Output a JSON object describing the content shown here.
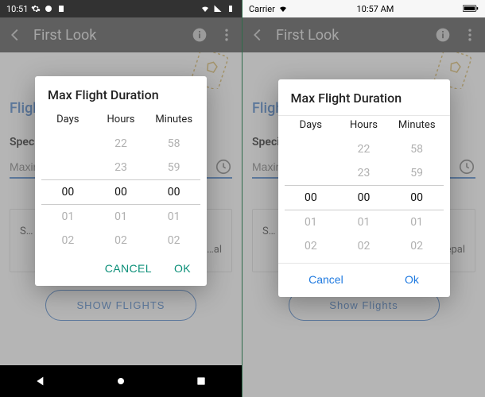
{
  "android": {
    "status": {
      "time": "10:51"
    },
    "appbar": {
      "title": "First Look"
    },
    "body": {
      "section_title": "Flight…",
      "specify": "Speci…",
      "input_placeholder": "Maximu…",
      "card_line1": "S…",
      "card_line2_suffix": "…al",
      "show_flights": "SHOW FLIGHTS"
    },
    "dialog": {
      "title": "Max Flight Duration",
      "columns": [
        "Days",
        "Hours",
        "Minutes"
      ],
      "rows": [
        [
          "",
          "22",
          "58"
        ],
        [
          "",
          "23",
          "59"
        ],
        [
          "00",
          "00",
          "00"
        ],
        [
          "01",
          "01",
          "01"
        ],
        [
          "02",
          "02",
          "02"
        ]
      ],
      "selected_index": 2,
      "cancel": "CANCEL",
      "ok": "OK"
    }
  },
  "ios": {
    "status": {
      "carrier": "Carrier",
      "time": "10:57 AM"
    },
    "appbar": {
      "title": "First Look"
    },
    "body": {
      "section_title": "Fligh…",
      "specify": "Specif…",
      "input_placeholder": "Maxim…",
      "card_line1": "S…",
      "card_line2_suffix": "…epal",
      "show_flights": "Show Flights"
    },
    "dialog": {
      "title": "Max Flight Duration",
      "columns": [
        "Days",
        "Hours",
        "Minutes"
      ],
      "rows": [
        [
          "",
          "22",
          "58"
        ],
        [
          "",
          "23",
          "59"
        ],
        [
          "00",
          "00",
          "00"
        ],
        [
          "01",
          "01",
          "01"
        ],
        [
          "02",
          "02",
          "02"
        ]
      ],
      "selected_index": 2,
      "cancel": "Cancel",
      "ok": "Ok"
    }
  },
  "icons": {
    "gear": "gear-icon",
    "back": "back-icon",
    "info": "info-icon",
    "more": "more-vert-icon",
    "clock": "clock-icon",
    "ticket": "ticket-icon"
  }
}
